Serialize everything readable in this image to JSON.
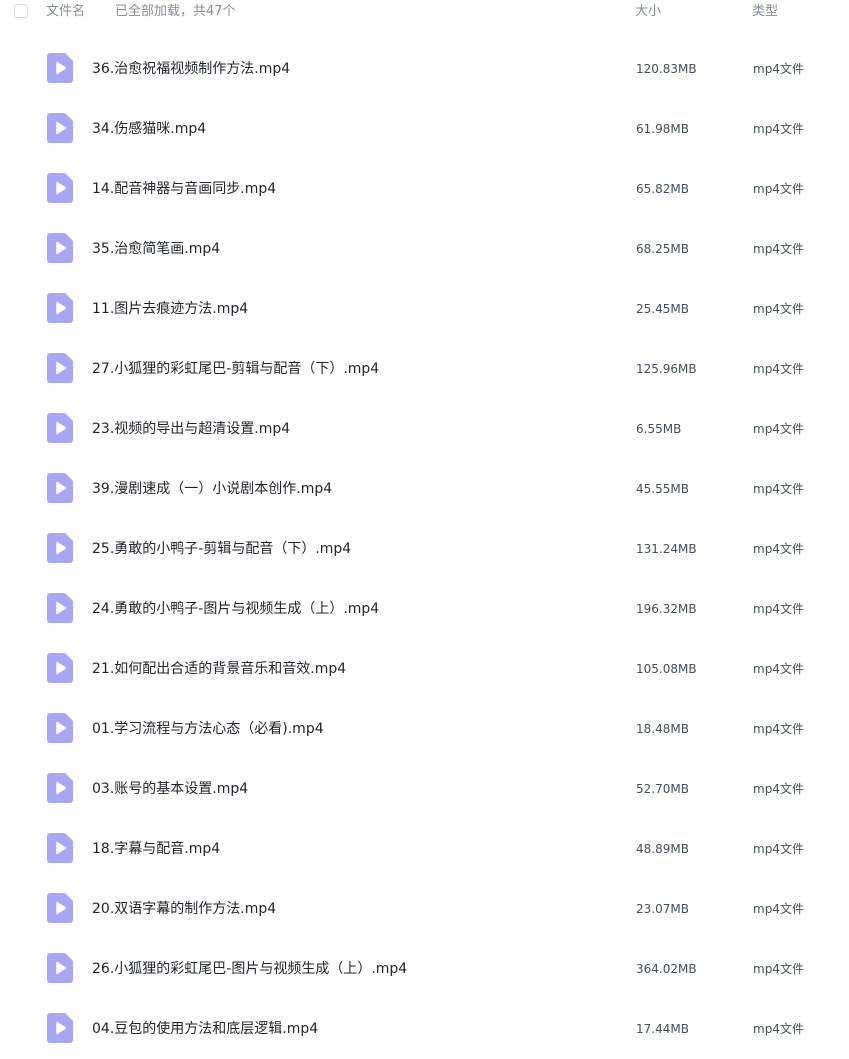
{
  "header": {
    "filename_label": "文件名",
    "loaded_status": "已全部加载，共47个",
    "size_label": "大小",
    "type_label": "类型"
  },
  "colors": {
    "icon_fill": "#a8a6f5",
    "icon_play": "#ffffff"
  },
  "files": [
    {
      "name": "36.治愈祝福视频制作方法.mp4",
      "size": "120.83MB",
      "type": "mp4文件",
      "icon": "video-file-icon"
    },
    {
      "name": "34.伤感猫咪.mp4",
      "size": "61.98MB",
      "type": "mp4文件",
      "icon": "video-file-icon"
    },
    {
      "name": "14.配音神器与音画同步.mp4",
      "size": "65.82MB",
      "type": "mp4文件",
      "icon": "video-file-icon"
    },
    {
      "name": "35.治愈简笔画.mp4",
      "size": "68.25MB",
      "type": "mp4文件",
      "icon": "video-file-icon"
    },
    {
      "name": "11.图片去痕迹方法.mp4",
      "size": "25.45MB",
      "type": "mp4文件",
      "icon": "video-file-icon"
    },
    {
      "name": "27.小狐狸的彩虹尾巴-剪辑与配音（下）.mp4",
      "size": "125.96MB",
      "type": "mp4文件",
      "icon": "video-file-icon"
    },
    {
      "name": "23.视频的导出与超清设置.mp4",
      "size": "6.55MB",
      "type": "mp4文件",
      "icon": "video-file-icon"
    },
    {
      "name": "39.漫剧速成（一）小说剧本创作.mp4",
      "size": "45.55MB",
      "type": "mp4文件",
      "icon": "video-file-icon"
    },
    {
      "name": "25.勇敢的小鸭子-剪辑与配音（下）.mp4",
      "size": "131.24MB",
      "type": "mp4文件",
      "icon": "video-file-icon"
    },
    {
      "name": "24.勇敢的小鸭子-图片与视频生成（上）.mp4",
      "size": "196.32MB",
      "type": "mp4文件",
      "icon": "video-file-icon"
    },
    {
      "name": "21.如何配出合适的背景音乐和音效.mp4",
      "size": "105.08MB",
      "type": "mp4文件",
      "icon": "video-file-icon"
    },
    {
      "name": "01.学习流程与方法心态（必看).mp4",
      "size": "18.48MB",
      "type": "mp4文件",
      "icon": "video-file-icon"
    },
    {
      "name": "03.账号的基本设置.mp4",
      "size": "52.70MB",
      "type": "mp4文件",
      "icon": "video-file-icon"
    },
    {
      "name": "18.字幕与配音.mp4",
      "size": "48.89MB",
      "type": "mp4文件",
      "icon": "video-file-icon"
    },
    {
      "name": "20.双语字幕的制作方法.mp4",
      "size": "23.07MB",
      "type": "mp4文件",
      "icon": "video-file-icon"
    },
    {
      "name": "26.小狐狸的彩虹尾巴-图片与视频生成（上）.mp4",
      "size": "364.02MB",
      "type": "mp4文件",
      "icon": "video-file-icon"
    },
    {
      "name": "04.豆包的使用方法和底层逻辑.mp4",
      "size": "17.44MB",
      "type": "mp4文件",
      "icon": "video-file-icon"
    }
  ]
}
